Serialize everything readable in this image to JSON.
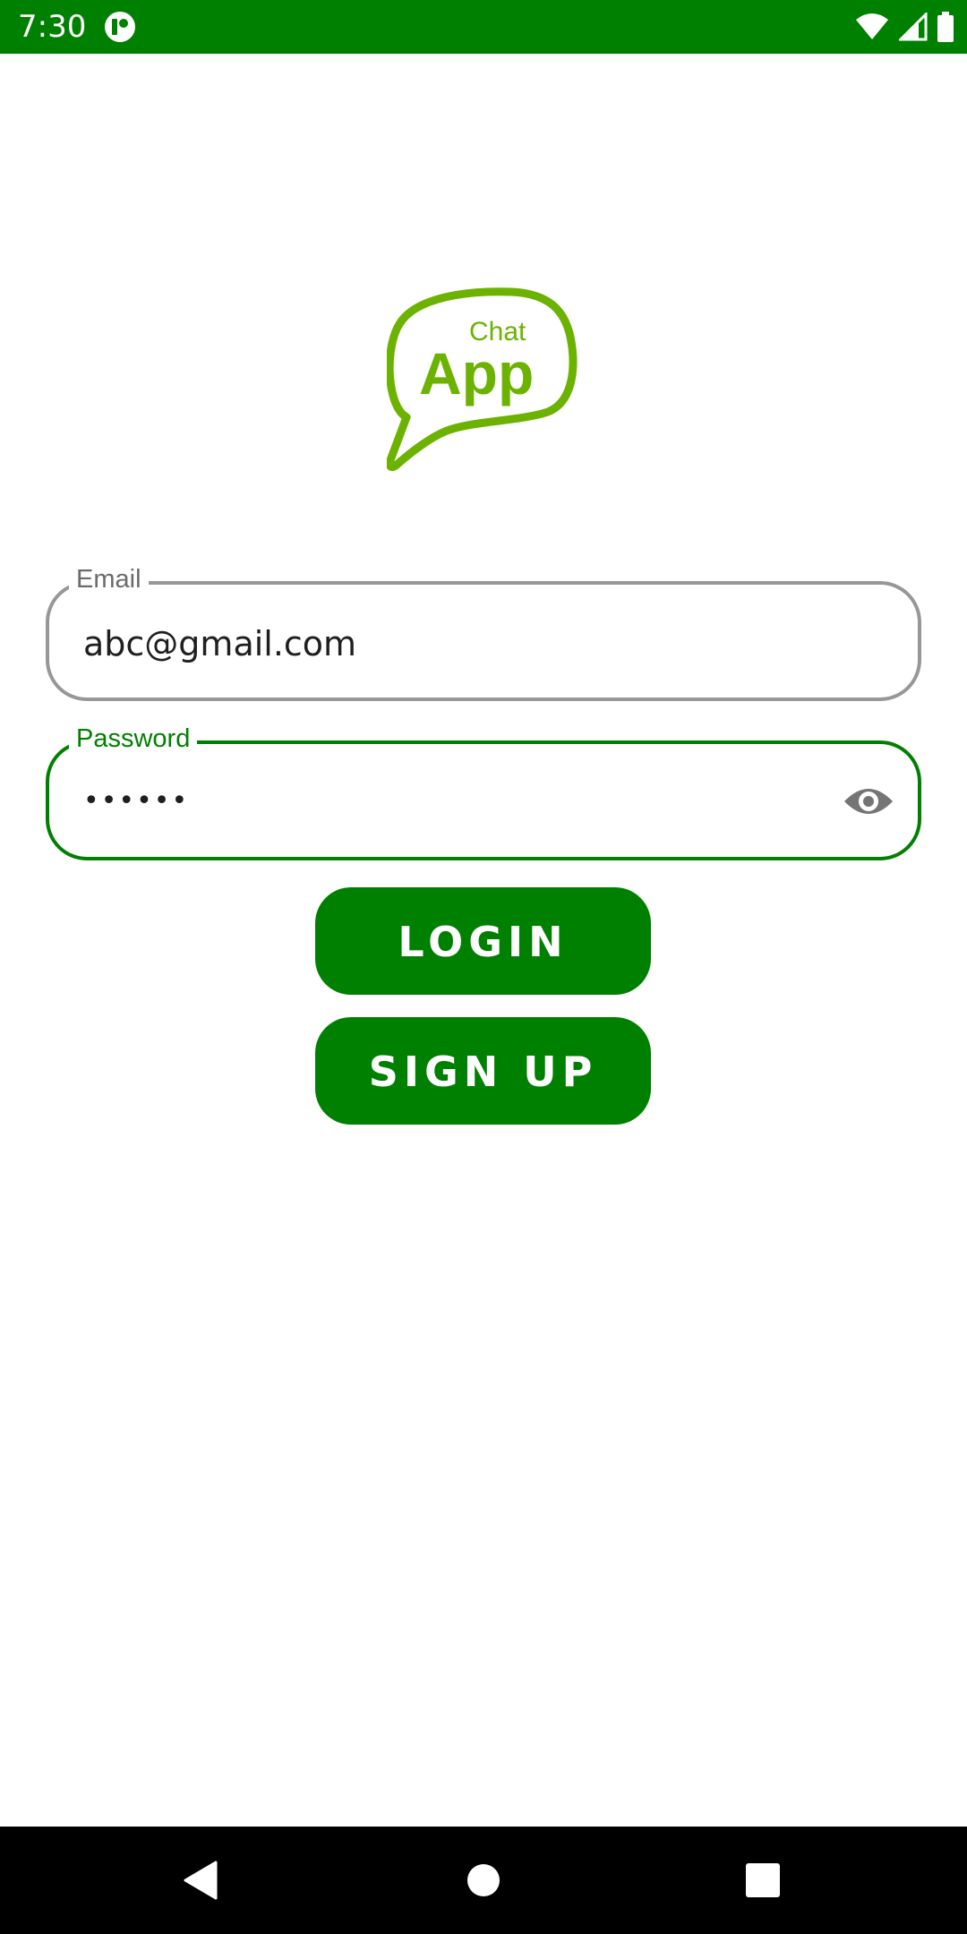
{
  "status_bar": {
    "time": "7:30",
    "background_color": "#008000",
    "icons": [
      "app-notification-icon",
      "wifi-icon",
      "cell-signal-icon",
      "battery-icon"
    ]
  },
  "logo": {
    "small_text": "Chat",
    "large_text": "App",
    "color": "#6bb300"
  },
  "form": {
    "email": {
      "label": "Email",
      "value": "abc@gmail.com"
    },
    "password": {
      "label": "Password",
      "masked_value": "••••••",
      "toggle_icon": "eye-icon"
    }
  },
  "buttons": {
    "login_label": "LOGIN",
    "signup_label": "SIGN UP"
  },
  "accent_color": "#008000",
  "nav_bar": {
    "icons": [
      "back-icon",
      "home-icon",
      "recents-icon"
    ]
  }
}
